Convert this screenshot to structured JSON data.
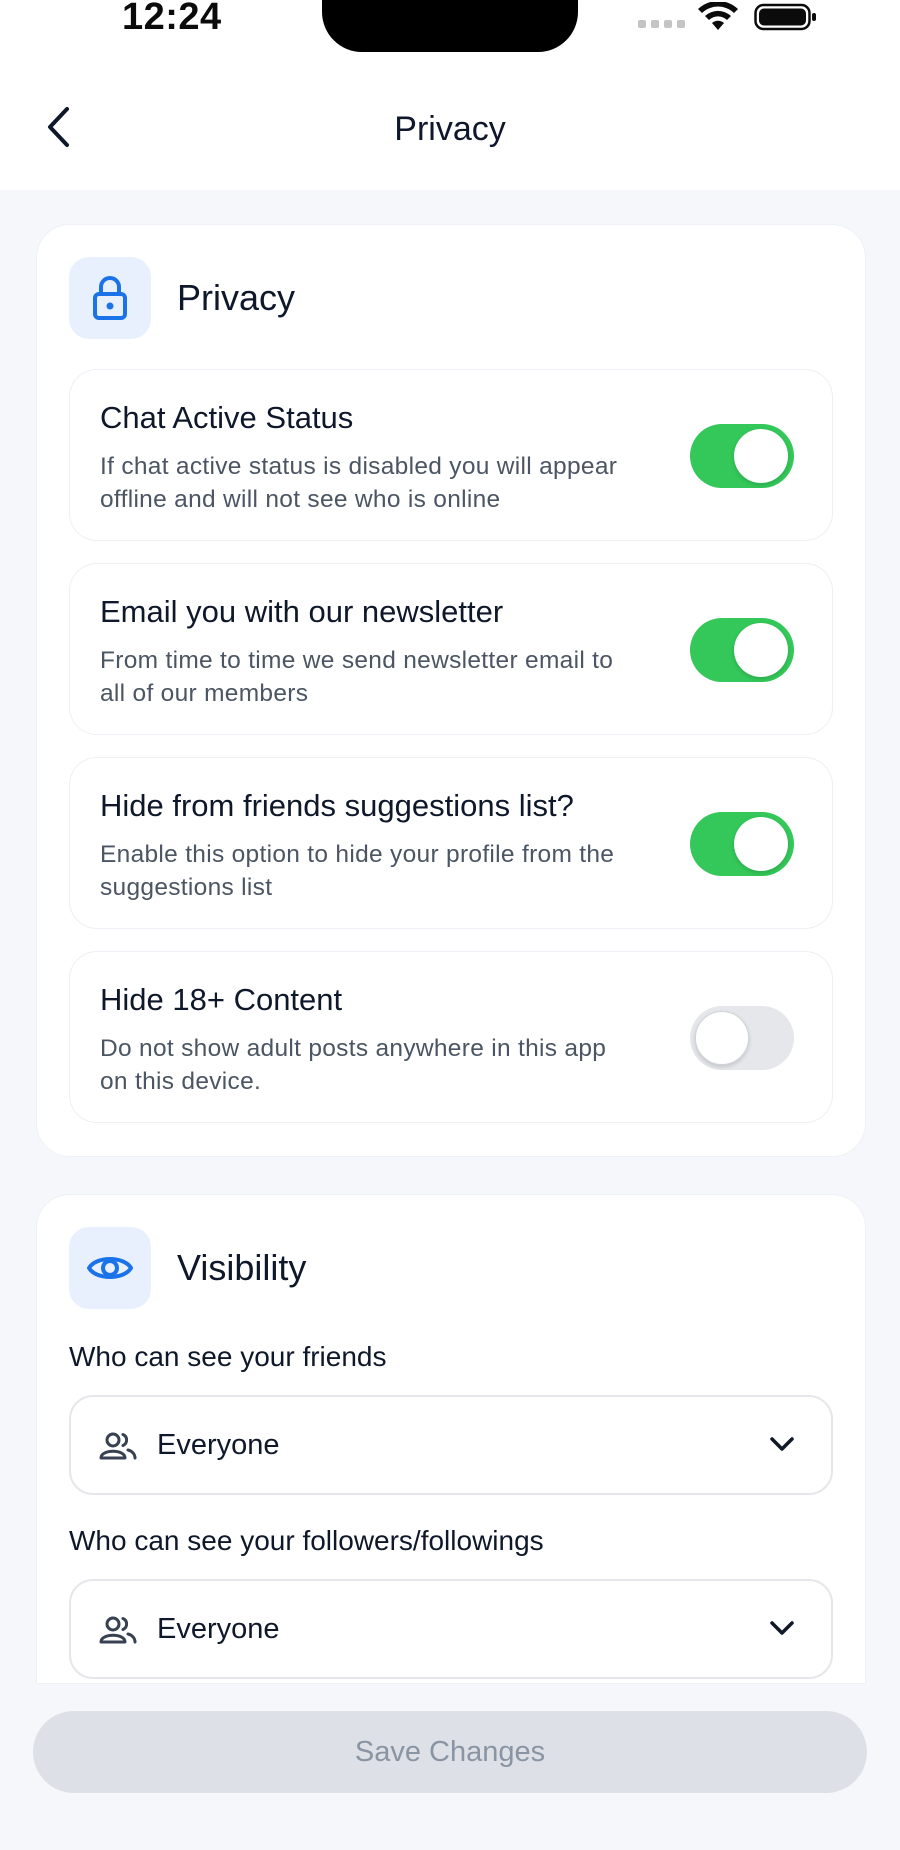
{
  "status_bar": {
    "time": "12:24"
  },
  "header": {
    "title": "Privacy"
  },
  "privacy_section": {
    "title": "Privacy",
    "icon": "lock-icon",
    "options": [
      {
        "title": "Chat Active Status",
        "desc_line1": "If chat active status is disabled you will appear",
        "desc_line2": "offline and will not see who is online",
        "enabled": true
      },
      {
        "title": "Email you with our newsletter",
        "desc_line1": "From time to time we send newsletter email to",
        "desc_line2": "all of our members",
        "enabled": true
      },
      {
        "title": "Hide from friends suggestions list?",
        "desc_line1": "Enable this option to hide your profile from the",
        "desc_line2": "suggestions list",
        "enabled": true
      },
      {
        "title": "Hide 18+ Content",
        "desc_line1": "Do not show adult posts anywhere in this app",
        "desc_line2": "on this device.",
        "enabled": false
      }
    ]
  },
  "visibility_section": {
    "title": "Visibility",
    "icon": "eye-icon",
    "fields": [
      {
        "label": "Who can see your friends",
        "value": "Everyone"
      },
      {
        "label": "Who can see your followers/followings",
        "value": "Everyone"
      }
    ]
  },
  "footer": {
    "save_label": "Save Changes"
  },
  "colors": {
    "accent": "#1a73e8",
    "toggle_on": "#34c759",
    "toggle_off": "#e5e7eb",
    "disabled_button": "#dde1e7"
  }
}
